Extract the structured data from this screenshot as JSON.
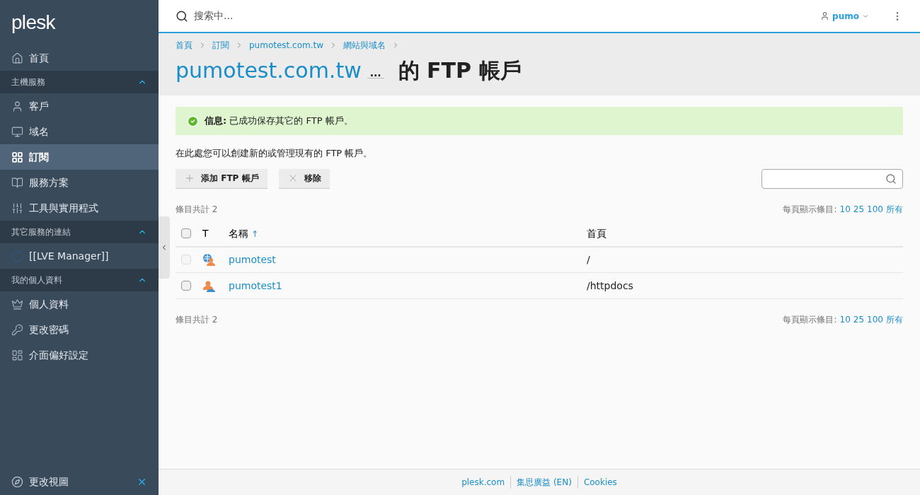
{
  "sidebar": {
    "logo": "plesk",
    "items": [
      {
        "kind": "link",
        "label": "首頁",
        "selected": false
      },
      {
        "kind": "section",
        "label": "主機服務",
        "expanded": true
      },
      {
        "kind": "link",
        "label": "客戶",
        "selected": false
      },
      {
        "kind": "link",
        "label": "域名",
        "selected": false
      },
      {
        "kind": "link",
        "label": "訂閱",
        "selected": true
      },
      {
        "kind": "link",
        "label": "服務方案",
        "selected": false
      },
      {
        "kind": "link",
        "label": "工具與實用程式",
        "selected": false
      },
      {
        "kind": "section",
        "label": "其它服務的連結",
        "expanded": true
      },
      {
        "kind": "link",
        "label": "[[LVE Manager]]",
        "selected": false
      },
      {
        "kind": "section",
        "label": "我的個人資料",
        "expanded": true
      },
      {
        "kind": "link",
        "label": "個人資料",
        "selected": false
      },
      {
        "kind": "link",
        "label": "更改密碼",
        "selected": false
      },
      {
        "kind": "link",
        "label": "介面偏好設定",
        "selected": false
      }
    ],
    "footer": "更改視圖"
  },
  "topbar": {
    "search": {
      "placeholder": "搜索中..."
    },
    "user": "pumo"
  },
  "breadcrumbs": [
    "首頁",
    "訂閱",
    "pumotest.com.tw",
    "網站與域名"
  ],
  "title": {
    "domain": "pumotest.com.tw",
    "more": "...",
    "rest": "的 FTP 帳戶"
  },
  "message": {
    "text": "**信息:** 已成功保存其它的 FTP 帳戶。"
  },
  "intro": "在此處您可以創建新的或管理現有的 FTP 帳戶。",
  "toolbar": {
    "buttons": [
      {
        "kind": "add",
        "label": "添加 FTP 帳戶"
      },
      {
        "kind": "remove",
        "label": "移除"
      }
    ]
  },
  "pager": {
    "total": "條目共計 2",
    "per_page_label": "每頁顯示條目:",
    "options": [
      "10",
      "25",
      "100",
      "所有"
    ]
  },
  "table": {
    "select_all": {
      "checked": false
    },
    "columns": [
      {
        "label": "T"
      },
      {
        "label": "名稱",
        "sort": "↑"
      },
      {
        "label": "首頁"
      }
    ],
    "rows": [
      {
        "kind": "web",
        "name": "pumotest",
        "home": "/",
        "checked": false,
        "disabled": true
      },
      {
        "kind": "user",
        "name": "pumotest1",
        "home": "/httpdocs",
        "checked": false,
        "disabled": false
      }
    ]
  },
  "pager_bottom": {
    "total": "條目共計 2",
    "per_page_label": "每頁顯示條目:",
    "options": [
      "10",
      "25",
      "100",
      "所有"
    ]
  },
  "footer_links": [
    "plesk.com",
    "集思廣益 (EN)",
    "Cookies"
  ]
}
